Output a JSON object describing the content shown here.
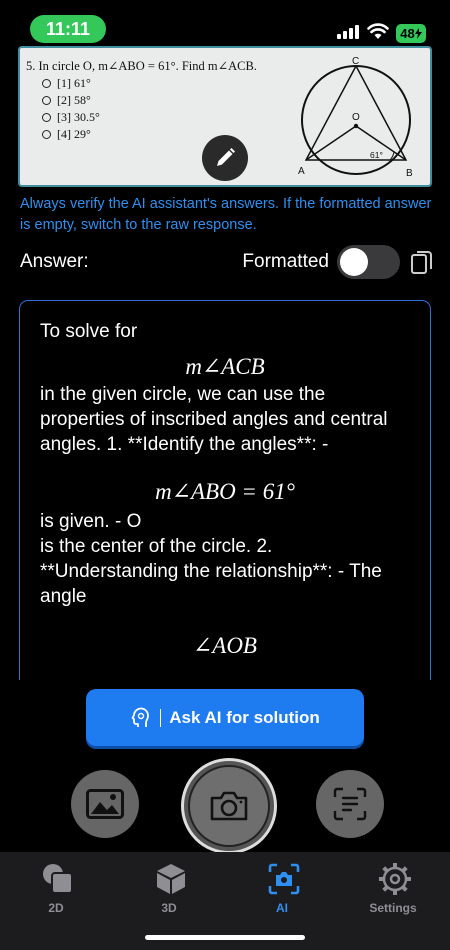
{
  "status": {
    "time": "11:11",
    "battery": "48"
  },
  "photo": {
    "question": "5. In circle O, m∠ABO = 61°. Find m∠ACB.",
    "options": [
      {
        "label": "[1] 61°"
      },
      {
        "label": "[2] 58°"
      },
      {
        "label": "[3] 30.5°"
      },
      {
        "label": "[4] 29°"
      }
    ],
    "diagram": {
      "point_c": "C",
      "point_o": "O",
      "point_a": "A",
      "point_b": "B",
      "angle_label": "61°"
    }
  },
  "notice": "Always verify the AI assistant's answers. If the formatted answer is empty, switch to the raw response.",
  "answer_row": {
    "answer_label": "Answer:",
    "formatted_label": "Formatted"
  },
  "answer": {
    "p1": "To solve for",
    "m1": "m∠ACB",
    "p2": "in the given circle, we can use the properties of inscribed angles and central angles.  1. **Identify the angles**:   -",
    "m2": "m∠ABO = 61°",
    "p3": "is given.    - O",
    "p4": "is the center of the circle.  2. **Understanding the relationship**:    - The angle",
    "m3": "∠AOB"
  },
  "ask_button": {
    "label": "Ask AI for solution"
  },
  "tabs": [
    {
      "label": "2D"
    },
    {
      "label": "3D"
    },
    {
      "label": "AI"
    },
    {
      "label": "Settings"
    }
  ],
  "colors": {
    "accent": "#2f8ff0",
    "status_green": "#34c759",
    "ask_button": "#1e7bf0"
  }
}
